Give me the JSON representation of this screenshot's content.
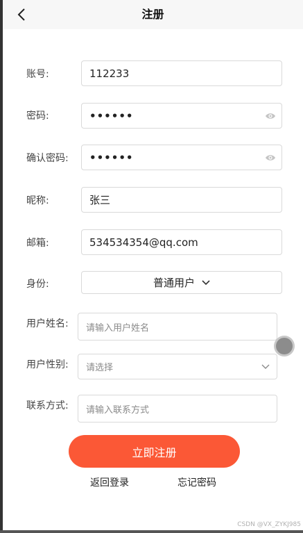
{
  "nav": {
    "title": "注册",
    "back_icon": "chevron-left-icon"
  },
  "form": {
    "account": {
      "label": "账号:",
      "value": "112233"
    },
    "password": {
      "label": "密码:",
      "value": "••••••",
      "icon": "eye-icon"
    },
    "confirm_password": {
      "label": "确认密码:",
      "value": "••••••",
      "icon": "eye-icon"
    },
    "nickname": {
      "label": "昵称:",
      "value": "张三"
    },
    "email": {
      "label": "邮箱:",
      "value": "534534354@qq.com"
    },
    "identity": {
      "label": "身份:",
      "value": "普通用户",
      "icon": "chevron-down-icon"
    },
    "user_name": {
      "label": "用户姓名:",
      "placeholder": "请输入用户姓名"
    },
    "user_gender": {
      "label": "用户性别:",
      "placeholder": "请选择",
      "icon": "chevron-down-icon"
    },
    "contact": {
      "label": "联系方式:",
      "placeholder": "请输入联系方式"
    }
  },
  "actions": {
    "submit_label": "立即注册",
    "back_login_label": "返回登录",
    "forgot_password_label": "忘记密码"
  },
  "watermark": "CSDN @VX_ZYKJ985",
  "colors": {
    "accent": "#fb5836",
    "border": "#d9d9d9",
    "placeholder": "#8a8a8a"
  }
}
